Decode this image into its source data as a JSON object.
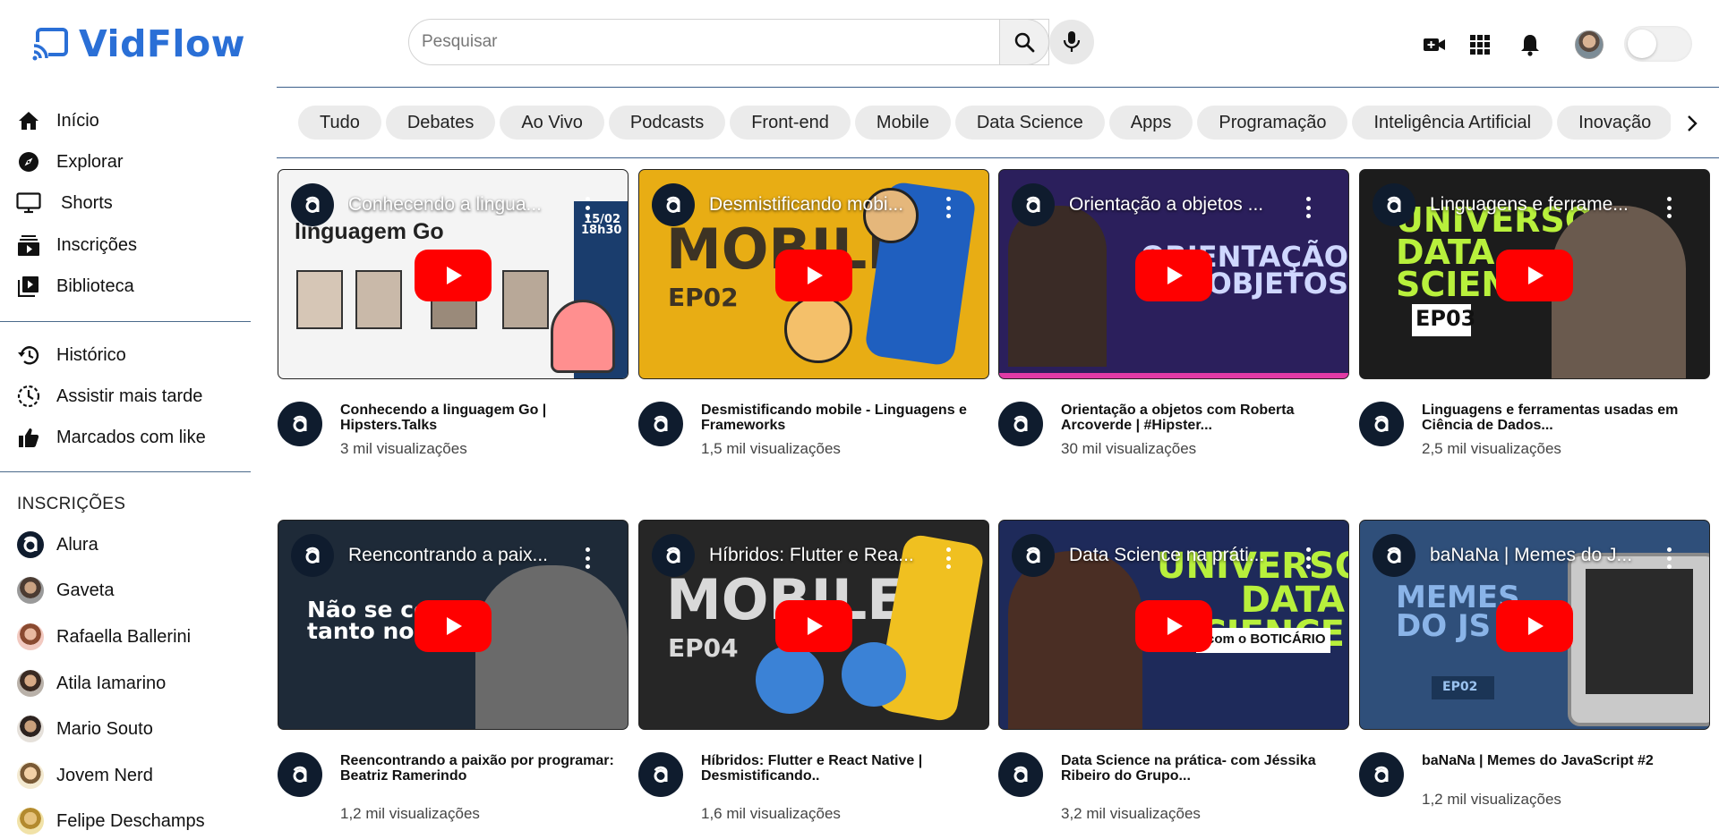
{
  "app": {
    "name": "VidFlow"
  },
  "header": {
    "search_placeholder": "Pesquisar",
    "icons": [
      "create-video-icon",
      "apps-grid-icon",
      "bell-icon",
      "avatar",
      "theme-toggle"
    ]
  },
  "sidebar": {
    "main": [
      {
        "label": "Início",
        "icon": "home-icon"
      },
      {
        "label": "Explorar",
        "icon": "compass-icon"
      },
      {
        "label": "Shorts",
        "icon": "shorts-icon"
      },
      {
        "label": "Inscrições",
        "icon": "subscriptions-icon"
      },
      {
        "label": "Biblioteca",
        "icon": "library-icon"
      }
    ],
    "personal": [
      {
        "label": "Histórico",
        "icon": "history-icon"
      },
      {
        "label": "Assistir mais tarde",
        "icon": "clock-icon"
      },
      {
        "label": "Marcados com like",
        "icon": "thumbs-up-icon"
      }
    ],
    "subscriptions_heading": "INSCRIÇÕES",
    "subscriptions": [
      {
        "name": "Alura"
      },
      {
        "name": "Gaveta"
      },
      {
        "name": "Rafaella Ballerini"
      },
      {
        "name": "Atila Iamarino"
      },
      {
        "name": "Mario Souto"
      },
      {
        "name": "Jovem Nerd"
      },
      {
        "name": "Felipe Deschamps"
      }
    ]
  },
  "chips": [
    "Tudo",
    "Debates",
    "Ao Vivo",
    "Podcasts",
    "Front-end",
    "Mobile",
    "Data Science",
    "Apps",
    "Programação",
    "Inteligência Artificial",
    "Inovação"
  ],
  "videos": [
    {
      "overlay": "Conhecendo a lingua...",
      "title": "Conhecendo a linguagem Go | Hipsters.Talks",
      "views": "3 mil visualizações",
      "thumb_text": "linguagem Go",
      "thumb_extra": "15/02 18h30",
      "bg": "#f4f4f4"
    },
    {
      "overlay": "Desmistificando mobi...",
      "title": "Desmistificando mobile - Linguagens e Frameworks",
      "views": "1,5 mil visualizações",
      "thumb_text": "MOBILE",
      "thumb_extra": "EP02",
      "bg": "#e8ad14"
    },
    {
      "overlay": "Orientação a objetos ...",
      "title": "Orientação a objetos com Roberta Arcoverde | #Hipster...",
      "views": "30 mil visualizações",
      "thumb_text": "ORIENTAÇÃO A OBJETOS",
      "thumb_extra": "",
      "bg": "#2b1f5c"
    },
    {
      "overlay": "Linguagens e ferrame...",
      "title": "Linguagens e ferramentas usadas em Ciência de Dados...",
      "views": "2,5 mil visualizações",
      "thumb_text": "UNIVERSO DATA SCIENCE",
      "thumb_extra": "EP03",
      "bg": "#1c1c1c"
    },
    {
      "overlay": "Reencontrando a paix...",
      "title": "Reencontrando a paixão por programar: Beatriz Ramerindo",
      "views": "1,2 mil visualizações",
      "thumb_text": "Não se co tanto no i",
      "thumb_extra": "",
      "bg": "#1e2a38"
    },
    {
      "overlay": "Híbridos: Flutter e Rea...",
      "title": "Híbridos: Flutter e React Native | Desmistificando..",
      "views": "1,6 mil visualizações",
      "thumb_text": "MOBILE",
      "thumb_extra": "EP04",
      "bg": "#262626"
    },
    {
      "overlay": "Data Science na práti...",
      "title": "Data Science na prática- com Jéssika Ribeiro do Grupo...",
      "views": "3,2 mil visualizações",
      "thumb_text": "UNIVERSO DATA SCIENCE",
      "thumb_extra": "com o BOTICÁRIO",
      "bg": "#1e2a5a"
    },
    {
      "overlay": "baNaNa | Memes do J...",
      "title": "baNaNa | Memes do JavaScript #2",
      "views": "1,2 mil visualizações",
      "thumb_text": "MEMES DO JS",
      "thumb_extra": "EP02",
      "bg": "#2f4f7a"
    }
  ],
  "colors": {
    "brand": "#2a6fd6",
    "play_button": "#ff0000",
    "channel_logo_bg": "#0f1c2e"
  }
}
